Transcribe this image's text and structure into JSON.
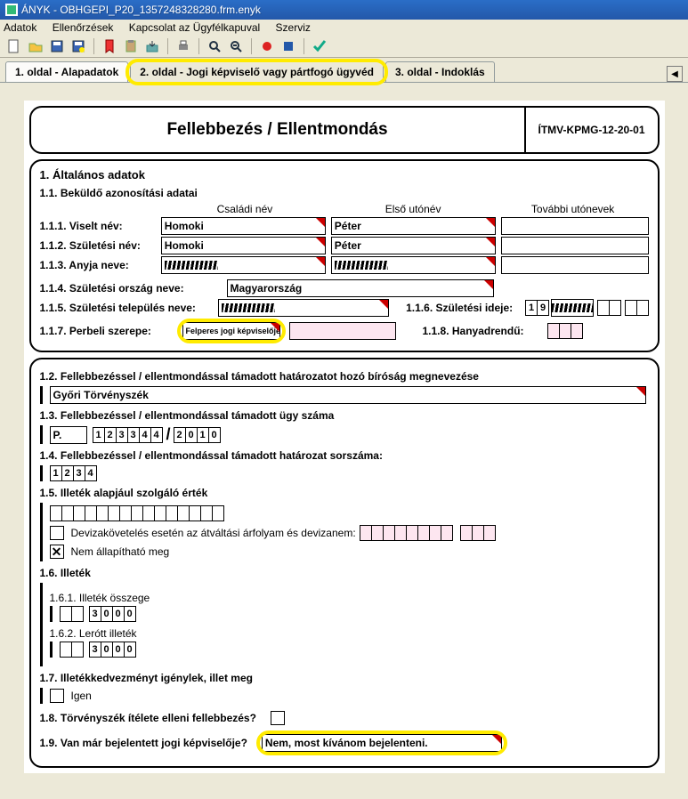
{
  "window": {
    "title": "ÁNYK - OBHGEPI_P20_1357248328280.frm.enyk"
  },
  "menu": [
    "Adatok",
    "Ellenőrzések",
    "Kapcsolat az Ügyfélkapuval",
    "Szerviz"
  ],
  "tabs": {
    "t1": "1. oldal - Alapadatok",
    "t2": "2. oldal - Jogi képviselő vagy pártfogó ügyvéd",
    "t3": "3. oldal - Indoklás"
  },
  "header": {
    "title": "Fellebbezés  / Ellentmondás",
    "code": "ÍTMV-KPMG-12-20-01"
  },
  "s1": {
    "title": "1. Általános adatok",
    "s11": "1.1. Beküldő azonosítási adatai",
    "cols": {
      "c1": "Családi név",
      "c2": "Első utónév",
      "c3": "További utónevek"
    },
    "r111": {
      "lbl": "1.1.1. Viselt név:",
      "v1": "Homoki",
      "v2": "Péter",
      "v3": ""
    },
    "r112": {
      "lbl": "1.1.2. Születési név:",
      "v1": "Homoki",
      "v2": "Péter",
      "v3": ""
    },
    "r113": {
      "lbl": "1.1.3. Anyja neve:"
    },
    "r114": {
      "lbl": "1.1.4. Születési ország neve:",
      "v": "Magyarország"
    },
    "r115": {
      "lbl": "1.1.5. Születési település neve:"
    },
    "r116": {
      "lbl": "1.1.6. Születési ideje:",
      "y1": "1",
      "y2": "9"
    },
    "r117": {
      "lbl": "1.1.7. Perbeli szerepe:",
      "v": "Felperes jogi képviselője"
    },
    "r118": {
      "lbl": "1.1.8. Hanyadrendű:"
    }
  },
  "s12": {
    "title": "1.2. Fellebbezéssel / ellentmondással támadott határozatot hozó bíróság megnevezése",
    "v": "Győri Törvényszék"
  },
  "s13": {
    "title": "1.3. Fellebbezéssel / ellentmondással támadott ügy száma",
    "p": "P.",
    "d": [
      "1",
      "2",
      "3",
      "3",
      "4",
      "4"
    ],
    "slash": "/",
    "y": [
      "2",
      "0",
      "1",
      "0"
    ]
  },
  "s14": {
    "title": "1.4. Fellebbezéssel  / ellentmondással támadott határozat sorszáma:",
    "d": [
      "1",
      "2",
      "3",
      "4"
    ]
  },
  "s15": {
    "title": "1.5. Illeték alapjául szolgáló érték",
    "chk1": "Devizakövetelés esetén az átváltási árfolyam és devizanem:",
    "chk2": "Nem állapítható meg"
  },
  "s16": {
    "title": "1.6. Illeték",
    "s161": "1.6.1. Illeték összege",
    "d1": [
      "",
      "",
      "3",
      "0",
      "0",
      "0"
    ],
    "s162": "1.6.2. Lerótt illeték",
    "d2": [
      "",
      "",
      "3",
      "0",
      "0",
      "0"
    ]
  },
  "s17": {
    "title": "1.7. Illetékkedvezményt igénylek, illet meg",
    "v": "Igen"
  },
  "s18": {
    "title": "1.8. Törvényszék ítélete elleni fellebbezés?"
  },
  "s19": {
    "title": "1.9. Van már bejelentett jogi képviselője?",
    "v": "Nem, most kívánom bejelenteni."
  }
}
